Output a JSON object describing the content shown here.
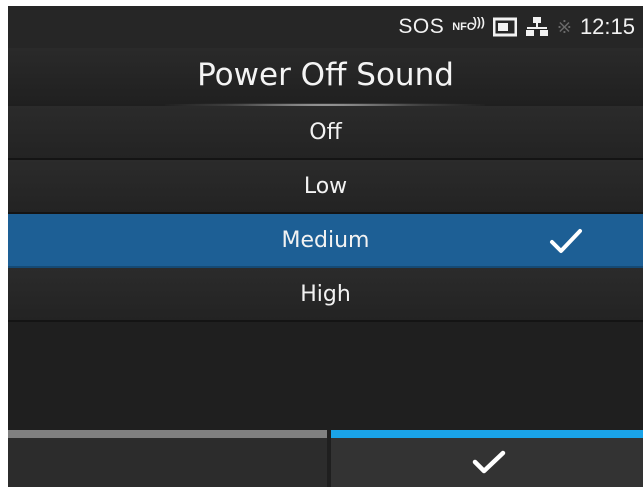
{
  "status_bar": {
    "sos_label": "SOS",
    "nfc_label": "NFC",
    "time": "12:15",
    "icons": [
      "nfc-icon",
      "sd-card-icon",
      "network-icon",
      "bluetooth-icon"
    ]
  },
  "header": {
    "title": "Power Off Sound"
  },
  "options": [
    {
      "label": "Off",
      "selected": false
    },
    {
      "label": "Low",
      "selected": false
    },
    {
      "label": "Medium",
      "selected": true
    },
    {
      "label": "High",
      "selected": false
    }
  ],
  "footer": {
    "left_button": "back",
    "right_button": "confirm-check"
  },
  "colors": {
    "selected_row": "#1d5f95",
    "confirm_accent": "#1aa3e8",
    "back_accent": "#808080",
    "background": "#1f1f1f"
  }
}
